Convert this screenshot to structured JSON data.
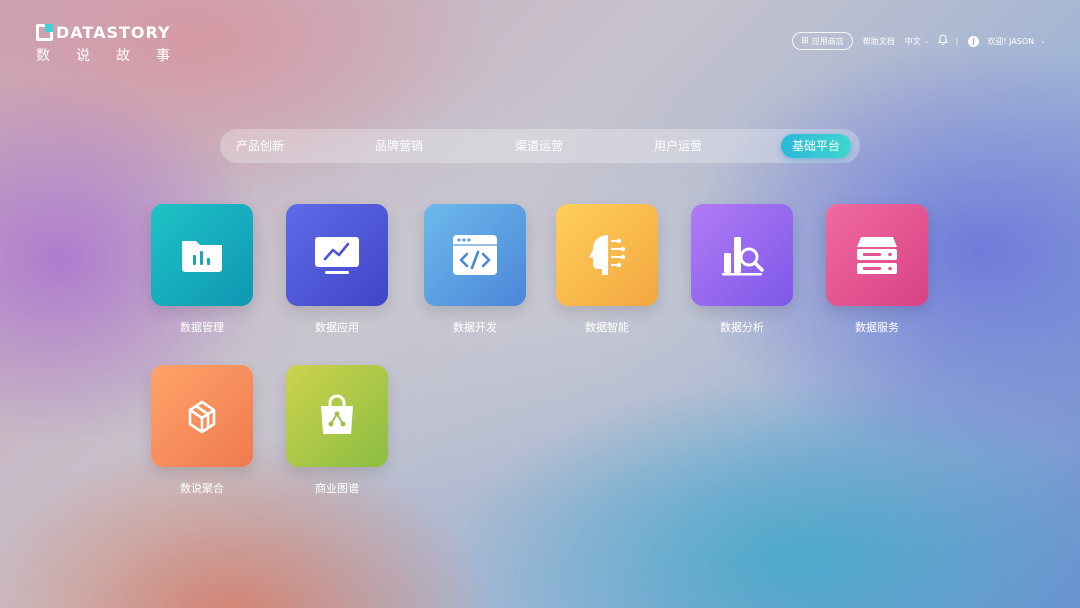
{
  "header": {
    "brand": "DATASTORY",
    "brand_sub": "数说故事",
    "store_label": "应用商店",
    "help_label": "帮助文档",
    "lang_label": "中文",
    "user_initial": "J",
    "welcome_label": "欢迎! JASON"
  },
  "tabs": [
    {
      "label": "产品创新"
    },
    {
      "label": "品牌营销"
    },
    {
      "label": "渠道运营"
    },
    {
      "label": "用户运营"
    },
    {
      "label": "基础平台",
      "active": true
    }
  ],
  "apps": [
    {
      "label": "数据管理",
      "icon": "folder-chart-icon",
      "colors": [
        "#1fc3c6",
        "#0e97b3"
      ]
    },
    {
      "label": "数据应用",
      "icon": "monitor-chart-icon",
      "colors": [
        "#5f6be8",
        "#3f45c8"
      ]
    },
    {
      "label": "数据开发",
      "icon": "code-window-icon",
      "colors": [
        "#6fb9ec",
        "#4a87d8"
      ]
    },
    {
      "label": "数据智能",
      "icon": "ai-head-icon",
      "colors": [
        "#ffcf5a",
        "#f3a640"
      ]
    },
    {
      "label": "数据分析",
      "icon": "chart-search-icon",
      "colors": [
        "#b27bf5",
        "#7d58e8"
      ]
    },
    {
      "label": "数据服务",
      "icon": "server-icon",
      "colors": [
        "#f16aa0",
        "#d84285"
      ]
    },
    {
      "label": "数说聚合",
      "icon": "cube-stack-icon",
      "colors": [
        "#ffa36a",
        "#f07a4e"
      ]
    },
    {
      "label": "商业图谱",
      "icon": "shopping-bag-icon",
      "colors": [
        "#cdd24c",
        "#8bbd42"
      ]
    }
  ]
}
